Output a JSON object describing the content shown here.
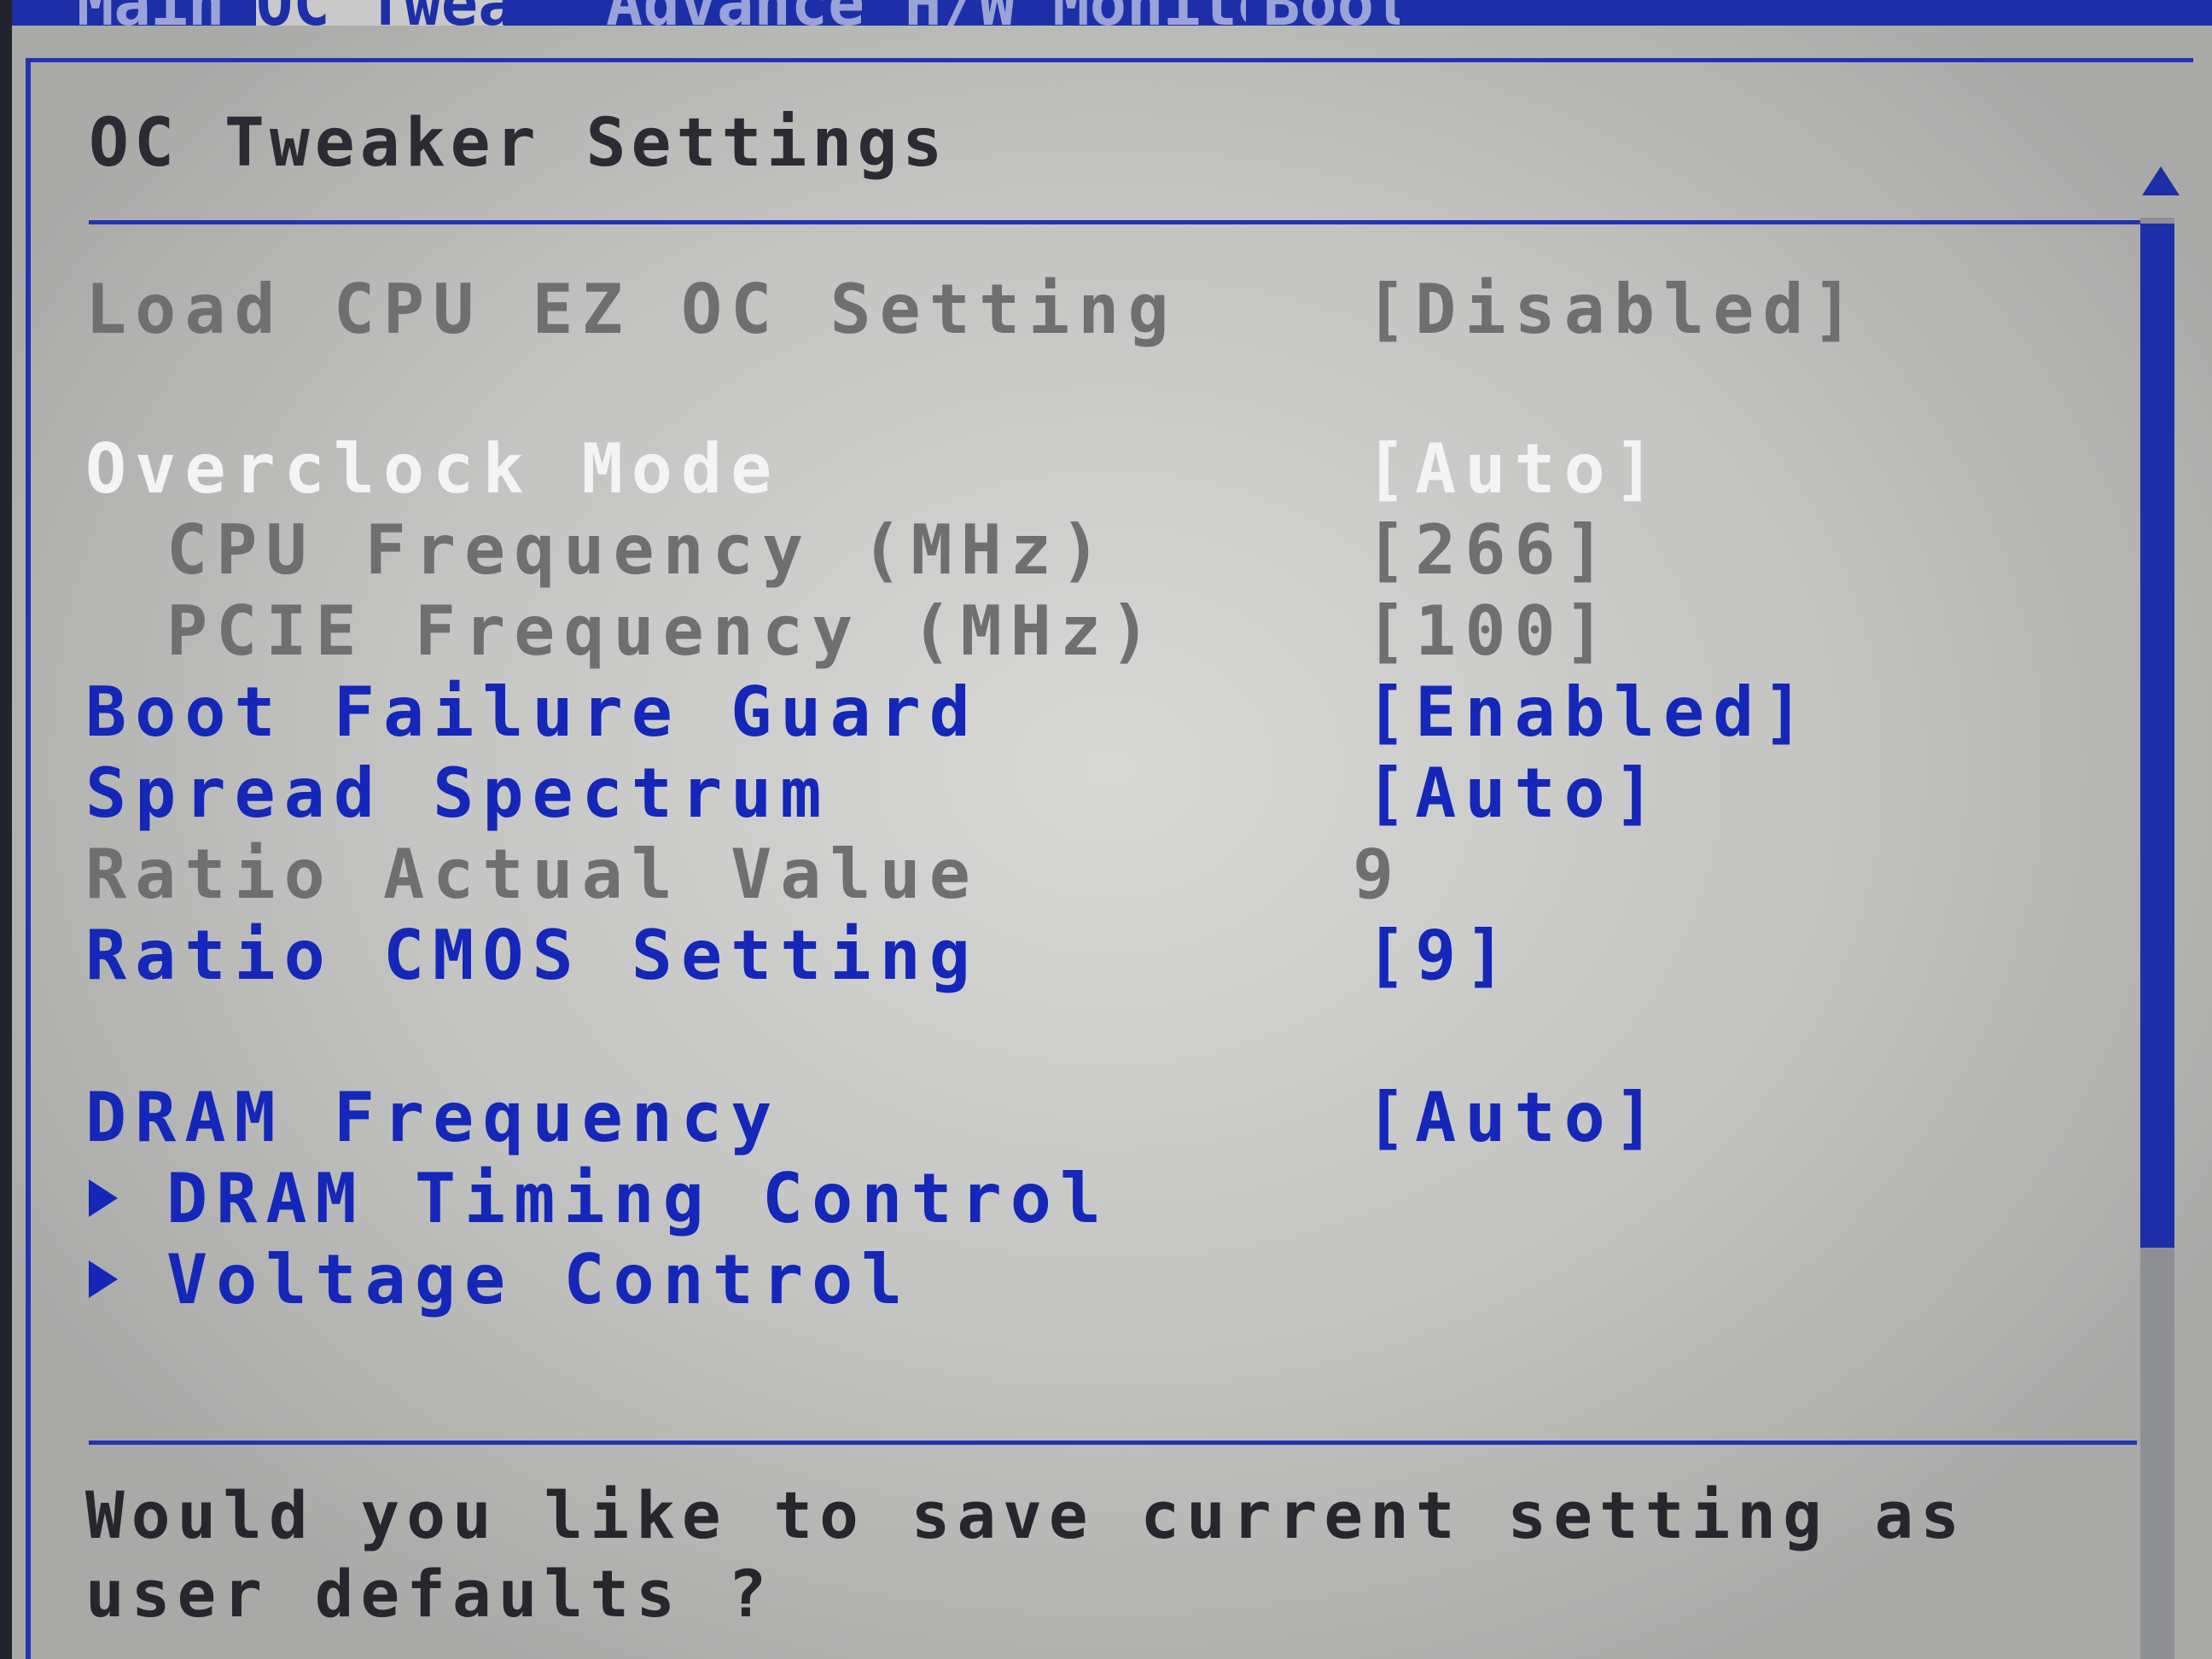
{
  "tabs": [
    {
      "label": "Main"
    },
    {
      "label": "OC Tweaker"
    },
    {
      "label": "Advanced"
    },
    {
      "label": "H/W Monitor"
    },
    {
      "label": "Boot"
    }
  ],
  "page_title": "OC Tweaker Settings",
  "settings": [
    {
      "label": "Load CPU EZ OC Setting",
      "value": "[Disabled]"
    },
    {
      "label": "Overclock Mode",
      "value": "[Auto]"
    },
    {
      "label": "CPU Frequency (MHz)",
      "value": "[266]"
    },
    {
      "label": "PCIE Frequency (MHz)",
      "value": "[100]"
    },
    {
      "label": "Boot Failure Guard",
      "value": "[Enabled]"
    },
    {
      "label": "Spread Spectrum",
      "value": "[Auto]"
    },
    {
      "label": "Ratio Actual Value",
      "value": "9"
    },
    {
      "label": "Ratio CMOS Setting",
      "value": "[9]"
    },
    {
      "label": "DRAM Frequency",
      "value": "[Auto]"
    }
  ],
  "submenus": [
    {
      "label": "DRAM Timing Control"
    },
    {
      "label": "Voltage Control"
    }
  ],
  "help_text": "Would you like to save current setting as\nuser defaults ?",
  "colors": {
    "accent_blue": "#1427b8",
    "disabled_gray": "#6f6f72",
    "highlight_white": "#f4f4f4"
  }
}
